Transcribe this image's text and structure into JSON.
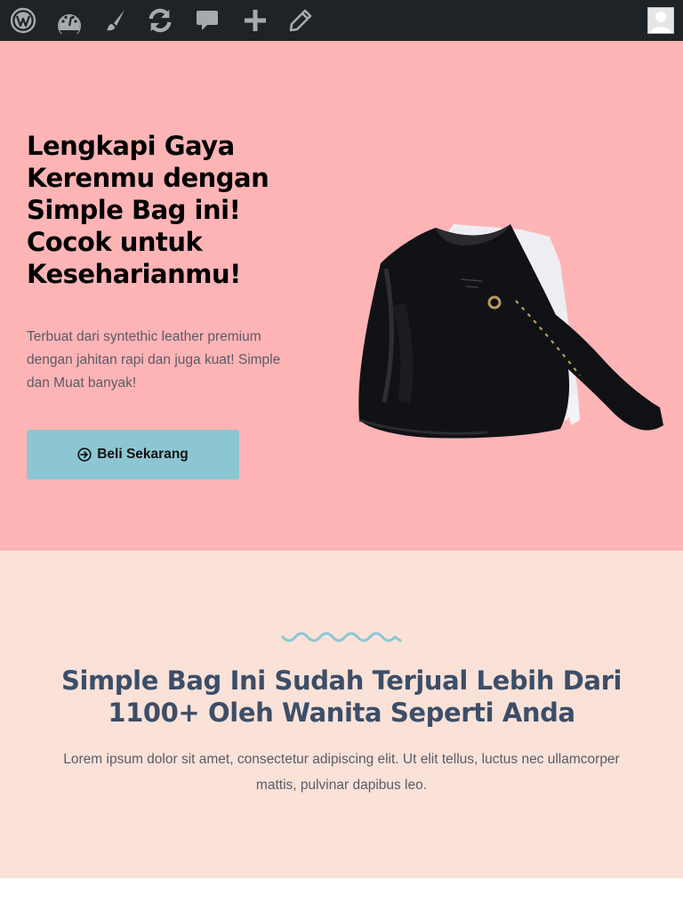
{
  "admin_bar": {
    "icons": [
      "wordpress-icon",
      "dashboard-icon",
      "customize-icon",
      "updates-icon",
      "comments-icon",
      "new-content-icon",
      "edit-icon",
      "user-avatar"
    ]
  },
  "hero": {
    "title": "Lengkapi Gaya Kerenmu dengan Simple Bag ini! Cocok untuk Keseharianmu!",
    "description": "Terbuat dari syntethic leather premium dengan jahitan rapi dan juga kuat! Simple dan Muat banyak!",
    "cta_label": "Beli Sekarang",
    "background": "#ffb4b6",
    "button_color": "#8dc6d3"
  },
  "social_proof": {
    "title": "Simple Bag Ini Sudah Terjual Lebih Dari 1100+ Oleh Wanita Seperti Anda",
    "description": "Lorem ipsum dolor sit amet, consectetur adipiscing elit. Ut elit tellus, luctus nec ullamcorper mattis, pulvinar dapibus leo.",
    "background": "#fae2d9",
    "title_color": "#3c4e68"
  }
}
